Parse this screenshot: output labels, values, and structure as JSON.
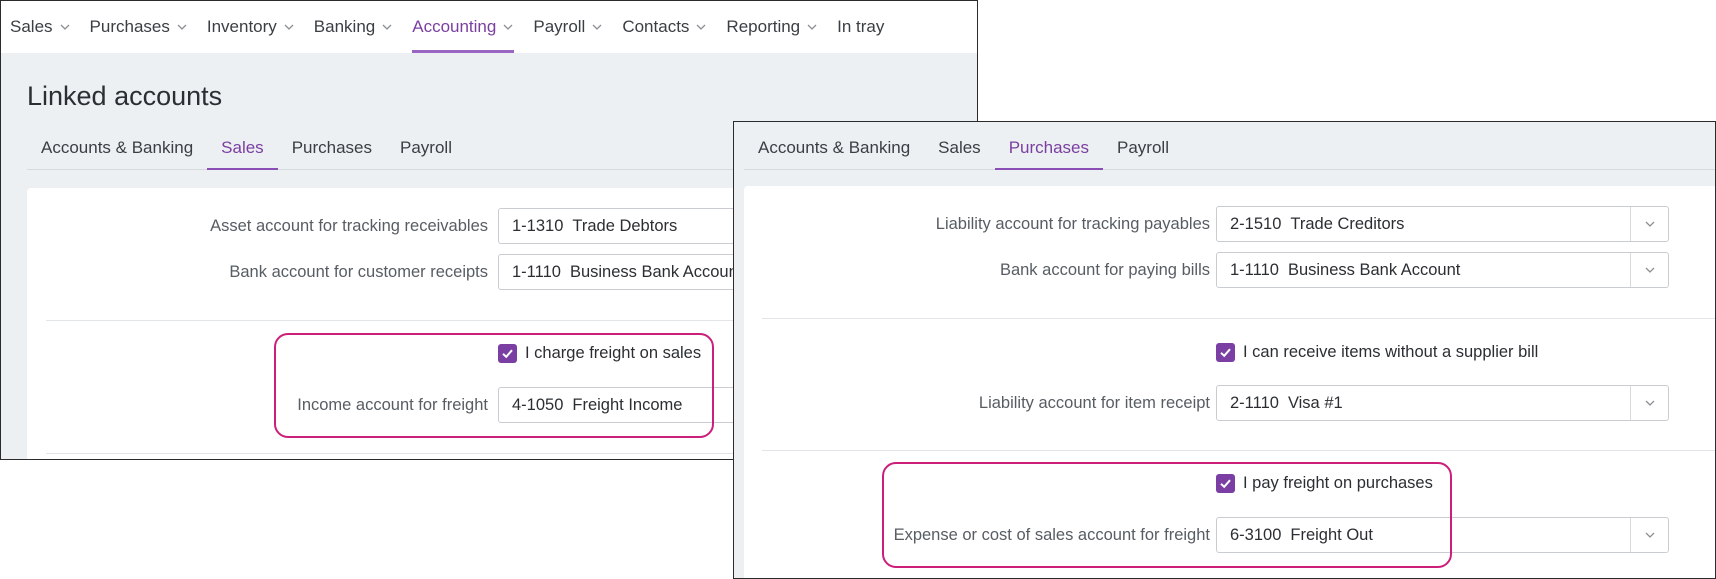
{
  "topnav": {
    "items": [
      {
        "label": "Sales",
        "has_menu": true,
        "active": false
      },
      {
        "label": "Purchases",
        "has_menu": true,
        "active": false
      },
      {
        "label": "Inventory",
        "has_menu": true,
        "active": false
      },
      {
        "label": "Banking",
        "has_menu": true,
        "active": false
      },
      {
        "label": "Accounting",
        "has_menu": true,
        "active": true
      },
      {
        "label": "Payroll",
        "has_menu": true,
        "active": false
      },
      {
        "label": "Contacts",
        "has_menu": true,
        "active": false
      },
      {
        "label": "Reporting",
        "has_menu": true,
        "active": false
      },
      {
        "label": "In tray",
        "has_menu": false,
        "active": false
      }
    ]
  },
  "left": {
    "title": "Linked accounts",
    "tabs": [
      {
        "label": "Accounts & Banking",
        "active": false
      },
      {
        "label": "Sales",
        "active": true
      },
      {
        "label": "Purchases",
        "active": false
      },
      {
        "label": "Payroll",
        "active": false
      }
    ],
    "receivables": {
      "label": "Asset account for tracking receivables",
      "num": "1-1310",
      "name": "Trade Debtors"
    },
    "receipts": {
      "label": "Bank account for customer receipts",
      "num": "1-1110",
      "name": "Business Bank Account"
    },
    "freight_check": {
      "label": "I charge freight on sales",
      "checked": true
    },
    "freight_account": {
      "label": "Income account for freight",
      "num": "4-1050",
      "name": "Freight Income"
    }
  },
  "right": {
    "tabs": [
      {
        "label": "Accounts & Banking",
        "active": false
      },
      {
        "label": "Sales",
        "active": false
      },
      {
        "label": "Purchases",
        "active": true
      },
      {
        "label": "Payroll",
        "active": false
      }
    ],
    "payables": {
      "label": "Liability account for tracking payables",
      "num": "2-1510",
      "name": "Trade Creditors"
    },
    "paying_bills": {
      "label": "Bank account for paying bills",
      "num": "1-1110",
      "name": "Business Bank Account"
    },
    "receive_check": {
      "label": "I can receive items without a supplier bill",
      "checked": true
    },
    "item_receipt": {
      "label": "Liability account for item receipt",
      "num": "2-1110",
      "name": "Visa #1"
    },
    "freight_check": {
      "label": "I pay freight on purchases",
      "checked": true
    },
    "freight_account": {
      "label": "Expense or cost of sales account for freight",
      "num": "6-3100",
      "name": "Freight Out"
    }
  },
  "colors": {
    "accent": "#7a3fa0",
    "checkbox": "#7b3fa4",
    "highlight": "#cc1f7a",
    "panel_bg": "#edf0f2"
  },
  "icons": {
    "menu_chevron": "chevron-down-icon",
    "select_chevron": "chevron-down-icon",
    "checkbox": "check-icon"
  }
}
